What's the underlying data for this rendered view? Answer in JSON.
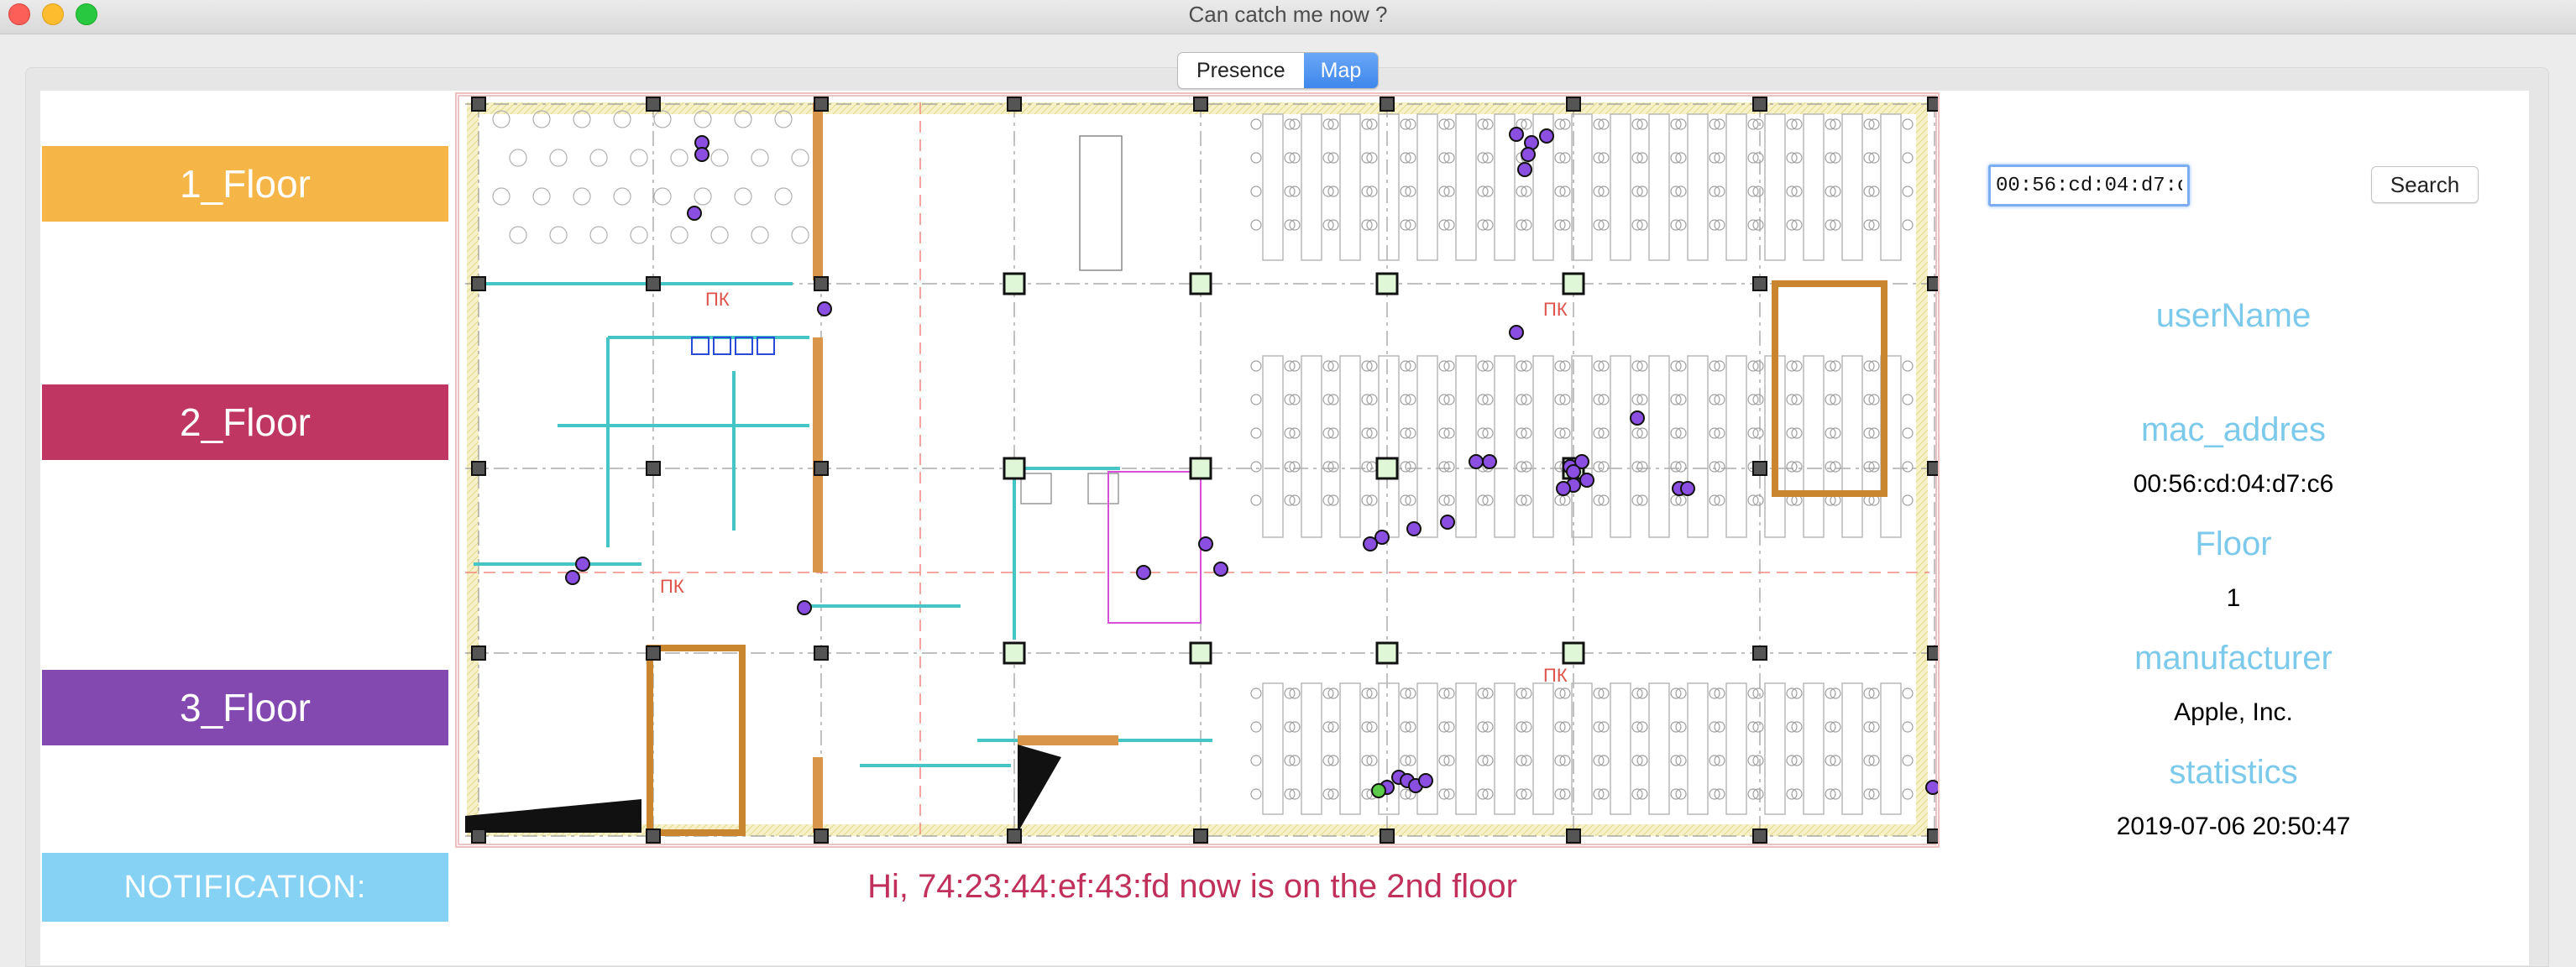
{
  "window": {
    "title": "Can catch me now ?"
  },
  "tabs": [
    {
      "label": "Presence",
      "active": false
    },
    {
      "label": "Map",
      "active": true
    }
  ],
  "floors": [
    {
      "label": "1_Floor",
      "color": "#f5b647"
    },
    {
      "label": "2_Floor",
      "color": "#bf3663"
    },
    {
      "label": "3_Floor",
      "color": "#8449b0"
    }
  ],
  "notification": {
    "label": "NOTIFICATION:",
    "label_color": "#86d2f4",
    "message": "Hi, 74:23:44:ef:43:fd now is on the 2nd floor",
    "message_color": "#c0305a"
  },
  "search": {
    "value": "00:56:cd:04:d7:c6",
    "button_label": "Search"
  },
  "info": {
    "label_color": "#7bc9eb",
    "username_label": "userName",
    "username_value": "",
    "mac_label": "mac_addres",
    "mac_value": "00:56:cd:04:d7:c6",
    "floor_label": "Floor",
    "floor_value": "1",
    "manufacturer_label": "manufacturer",
    "manufacturer_value": "Apple, Inc.",
    "statistics_label": "statistics",
    "statistics_value": "2019-07-06 20:50:47"
  },
  "map": {
    "device_color": "#8a4ee0",
    "highlight_color": "#5ccb49",
    "room_labels": [
      "ПК",
      "ПК",
      "ПК",
      "ПК"
    ]
  }
}
